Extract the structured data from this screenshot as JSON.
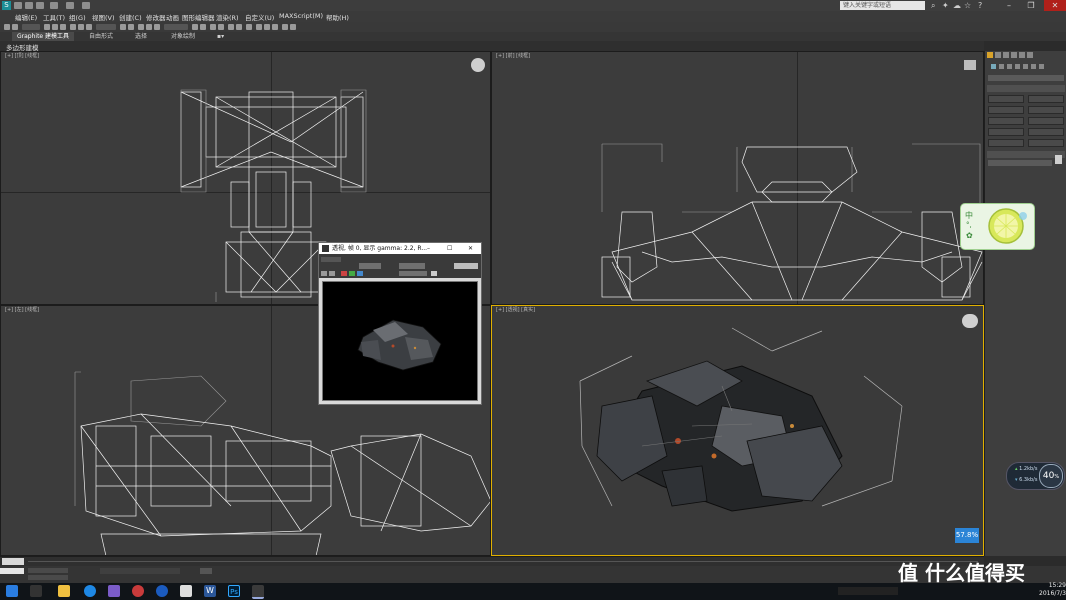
{
  "titlebar": {
    "search_placeholder": "键入关键字或短语"
  },
  "menu": [
    "编辑(E)",
    "工具(T)",
    "组(G)",
    "视图(V)",
    "创建(C)",
    "修改器",
    "动画",
    "图形编辑器",
    "渲染(R)",
    "自定义(U)",
    "MAXScript(M)",
    "帮助(H)"
  ],
  "ribbon": {
    "tabs": [
      "Graphite 建模工具",
      "自由形式",
      "选择",
      "对象绘制"
    ],
    "sub_label": "多边形建模"
  },
  "render_window": {
    "title": "透视, 帧 0, 显示 gamma: 2.2, R..."
  },
  "widgets": {
    "perf_up": "1.2",
    "perf_down": "6.3",
    "perf_unit": "kb/s",
    "perf_percent": "40",
    "perf_percent_sign": "%",
    "zoom": "57.8%"
  },
  "watermark": "值 什么值得买",
  "clock": {
    "time": "15:29",
    "date": "2016/7/3"
  },
  "colors": {
    "accent_active_viewport": "#e0b000",
    "close_button": "#b0201a",
    "zoom_badge": "#2b84d6"
  }
}
